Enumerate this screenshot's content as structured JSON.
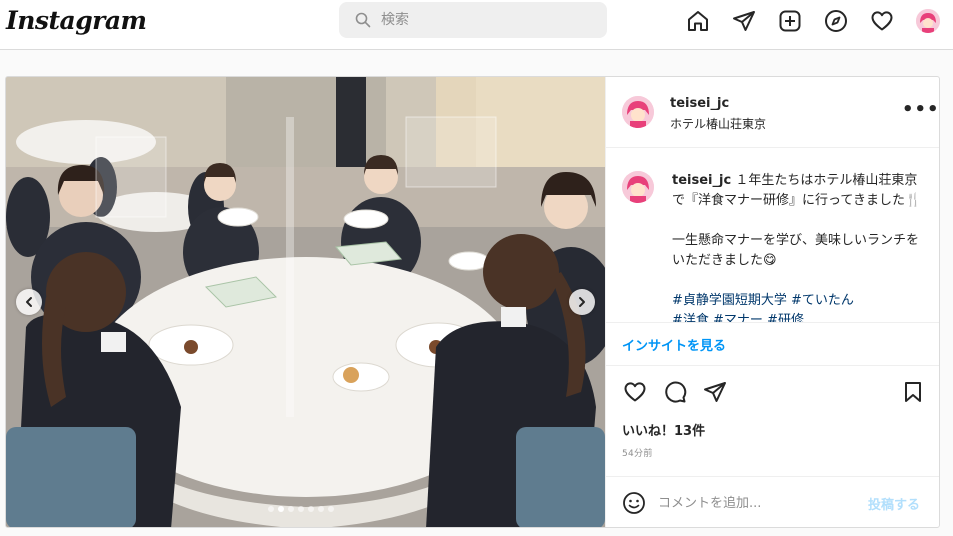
{
  "header": {
    "logo": "Instagram",
    "search_placeholder": "検索",
    "icons": [
      "home-icon",
      "direct-icon",
      "new-post-icon",
      "explore-icon",
      "activity-heart-icon",
      "profile-avatar"
    ]
  },
  "post": {
    "username": "teisei_jc",
    "location": "ホテル椿山荘東京",
    "caption": {
      "username": "teisei_jc",
      "line1": "１年生たちはホテル椿山荘東京で『洋食マナー研修』に行ってきました",
      "line1_emoji": "🍴",
      "line2": "一生懸命マナーを学び、美味しいランチをいただきました",
      "line2_emoji": "😋",
      "hashtags": "#貞静学園短期大学 #ていたん",
      "hashtags_cont": "#洋食 #マナー #研修"
    },
    "insights_label": "インサイトを見る",
    "likes": "いいね！13件",
    "time": "54分前",
    "comment_placeholder": "コメントを追加...",
    "post_button": "投稿する",
    "carousel": {
      "count": 7,
      "active_index": 1
    }
  },
  "colors": {
    "link_blue": "#0095f6",
    "post_disabled": "#b2dffc",
    "border": "#dbdbdb",
    "text": "#262626",
    "muted": "#8e8e8e"
  }
}
